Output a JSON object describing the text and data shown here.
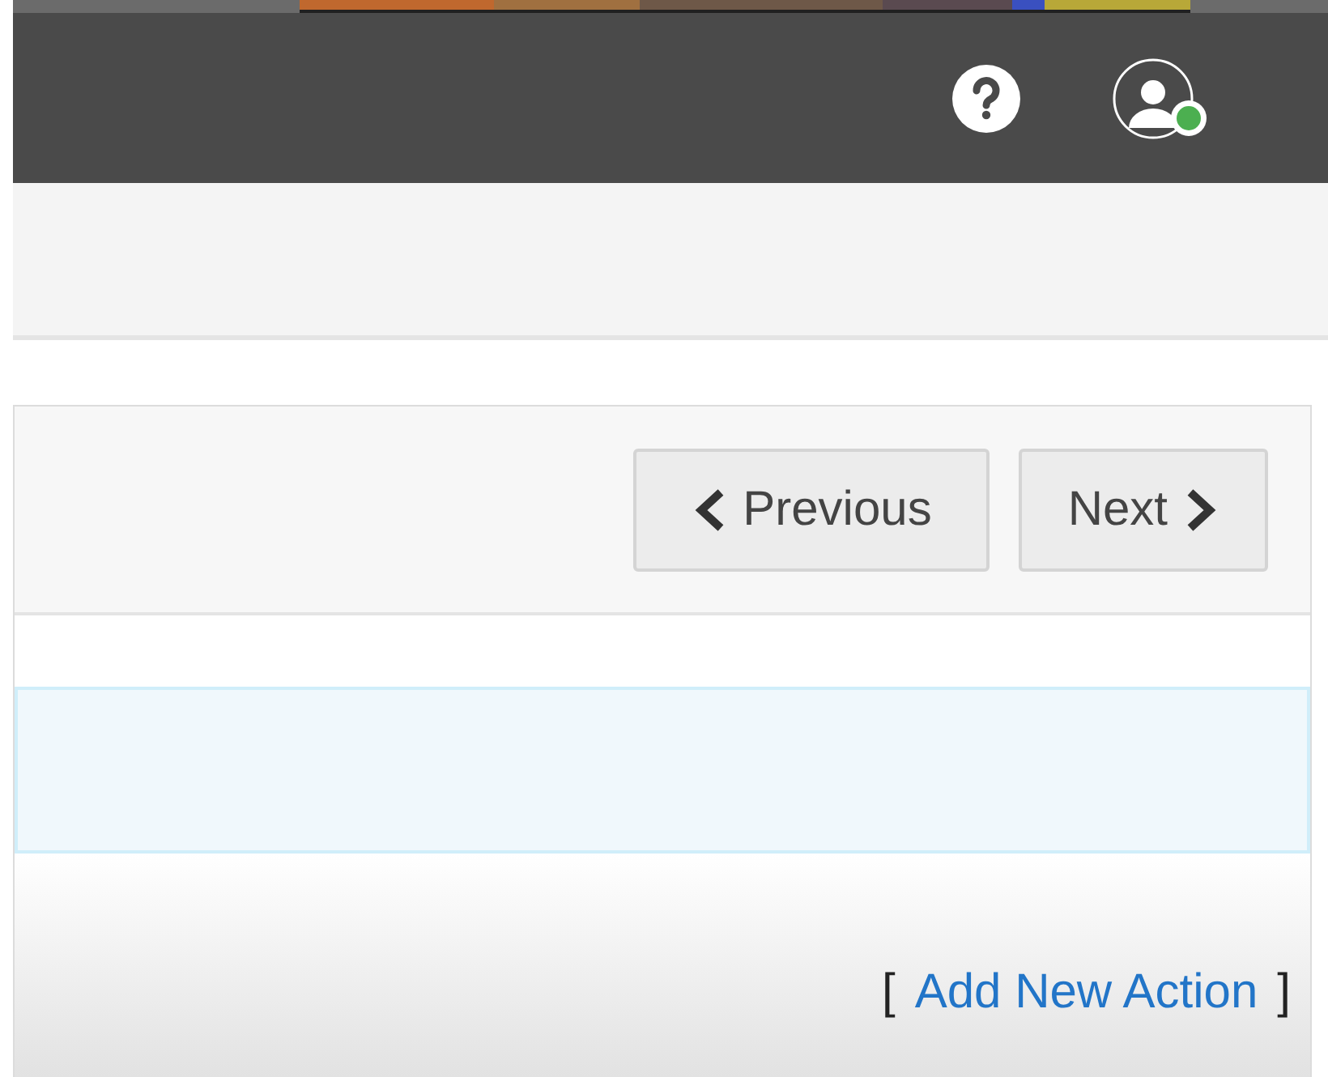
{
  "header": {
    "user_online": true
  },
  "pagination": [
    {
      "kind": "previous",
      "label": "Previous"
    },
    {
      "kind": "next",
      "label": "Next"
    }
  ],
  "selected_row": {
    "selected": true
  },
  "footer": {
    "open_bracket": "[",
    "link": "Add New Action",
    "close_bracket": "]"
  }
}
